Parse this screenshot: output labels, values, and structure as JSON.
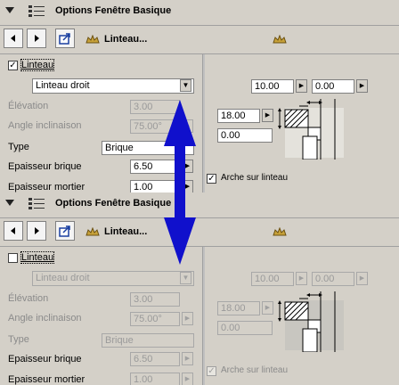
{
  "panels": [
    {
      "title": "Options Fenêtre Basique",
      "toolbar_label": "Linteau...",
      "lintel_checked": true,
      "lintel_label": "Linteau",
      "lintel_type_select": "Linteau droit",
      "elevation_label": "Élévation",
      "elevation_value": "3.00",
      "angle_label": "Angle inclinaison",
      "angle_value": "75.00°",
      "type_label": "Type",
      "type_value": "Brique",
      "brick_thickness_label": "Epaisseur brique",
      "brick_thickness_value": "6.50",
      "mortar_thickness_label": "Epaisseur mortier",
      "mortar_thickness_value": "1.00",
      "right_top_value_1": "10.00",
      "right_top_value_2": "0.00",
      "right_left_value_1": "18.00",
      "right_left_value_2": "0.00",
      "arch_checked": true,
      "arch_label": "Arche sur linteau"
    },
    {
      "title": "Options Fenêtre Basique",
      "toolbar_label": "Linteau...",
      "lintel_checked": false,
      "lintel_label": "Linteau",
      "lintel_type_select": "Linteau droit",
      "elevation_label": "Élévation",
      "elevation_value": "3.00",
      "angle_label": "Angle inclinaison",
      "angle_value": "75.00°",
      "type_label": "Type",
      "type_value": "Brique",
      "brick_thickness_label": "Epaisseur brique",
      "brick_thickness_value": "6.50",
      "mortar_thickness_label": "Epaisseur mortier",
      "mortar_thickness_value": "1.00",
      "right_top_value_1": "10.00",
      "right_top_value_2": "0.00",
      "right_left_value_1": "18.00",
      "right_left_value_2": "0.00",
      "arch_checked": true,
      "arch_label": "Arche sur linteau"
    }
  ],
  "icons": {
    "collapse": "collapse-triangle-icon",
    "list": "list-options-icon",
    "prev": "arrow-left-icon",
    "next": "arrow-right-icon",
    "settings": "export-settings-icon",
    "lintel": "lintel-icon",
    "ornament": "ornament-icon",
    "annotation_arrow": "double-headed-arrow-icon"
  },
  "colors": {
    "annotation_arrow": "#1010cc"
  }
}
